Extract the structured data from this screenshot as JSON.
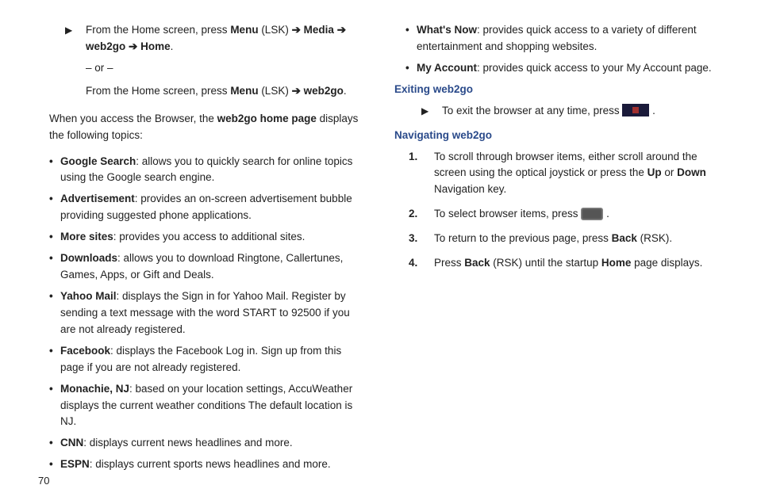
{
  "pageNumber": "70",
  "left": {
    "step1a_pre": "From the Home screen, press ",
    "menu": "Menu",
    "lsk": " (LSK) ",
    "arrow": "➔",
    "media": "Media",
    "web2go": "web2go",
    "home": "Home",
    "or": "– or –",
    "step1b_pre": "From the Home screen, press ",
    "step1b_post": ".",
    "intro_pre": "When you access the Browser, the ",
    "intro_bold": "web2go home page",
    "intro_post": " displays the following topics:",
    "bullets": [
      {
        "t": "Google Search",
        "d": ": allows you to quickly search for online topics using the Google search engine."
      },
      {
        "t": "Advertisement",
        "d": ": provides an on-screen advertisement bubble providing suggested phone applications."
      },
      {
        "t": "More sites",
        "d": ": provides you access to additional sites."
      },
      {
        "t": "Downloads",
        "d": ": allows you to download Ringtone, Callertunes, Games, Apps, or Gift and Deals."
      },
      {
        "t": "Yahoo Mail",
        "d": ": displays the Sign in for Yahoo Mail. Register by sending a text message with the word START to 92500 if you are not already registered."
      },
      {
        "t": "Facebook",
        "d": ": displays the Facebook Log in. Sign up from this page if you are not already registered."
      },
      {
        "t": "Monachie, NJ",
        "d": ": based on your location settings, AccuWeather displays the current weather conditions The default location is NJ."
      },
      {
        "t": "CNN",
        "d": ": displays current news headlines and more."
      },
      {
        "t": "ESPN",
        "d": ": displays current sports news headlines and more."
      }
    ]
  },
  "right": {
    "topBullets": [
      {
        "t": "What's Now",
        "d": ": provides quick access to a variety of different entertainment and shopping websites."
      },
      {
        "t": "My Account",
        "d": ": provides quick access to your My Account page."
      }
    ],
    "h1": "Exiting web2go",
    "exit_pre": "To exit the browser at any time, press  ",
    "exit_post": " .",
    "h2": "Navigating web2go",
    "n1_pre": "To scroll through browser items, either scroll around the screen using the optical joystick or press the ",
    "up": "Up",
    "orword": " or ",
    "down": "Down",
    "n1_post": " Navigation key.",
    "n2_pre": "To select browser items, press  ",
    "n2_post": " .",
    "n3_pre": "To return to the previous page, press ",
    "back": "Back",
    "rsk": " (RSK).",
    "n4_pre": "Press ",
    "n4_mid": " (RSK) until the startup ",
    "homeword": "Home",
    "n4_post": " page displays."
  }
}
